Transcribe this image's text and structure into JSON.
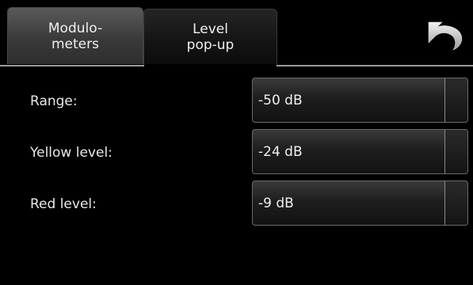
{
  "tabs": [
    {
      "label_line1": "Modulo-",
      "label_line2": "meters",
      "active": true
    },
    {
      "label_line1": "Level",
      "label_line2": "pop-up",
      "active": false
    }
  ],
  "toolbar": {
    "undo_icon": "undo-arrow-icon"
  },
  "settings": [
    {
      "label": "Range:",
      "value": "-50 dB"
    },
    {
      "label": "Yellow level:",
      "value": "-24 dB"
    },
    {
      "label": "Red level:",
      "value": "-9 dB"
    }
  ]
}
